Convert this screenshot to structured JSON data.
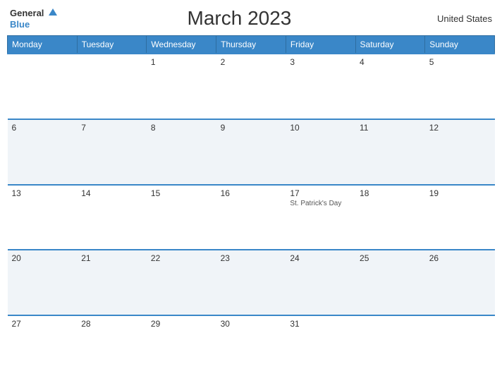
{
  "header": {
    "logo_general": "General",
    "logo_blue": "Blue",
    "title": "March 2023",
    "country": "United States"
  },
  "columns": [
    "Monday",
    "Tuesday",
    "Wednesday",
    "Thursday",
    "Friday",
    "Saturday",
    "Sunday"
  ],
  "weeks": [
    [
      {
        "day": "",
        "event": ""
      },
      {
        "day": "",
        "event": ""
      },
      {
        "day": "1",
        "event": ""
      },
      {
        "day": "2",
        "event": ""
      },
      {
        "day": "3",
        "event": ""
      },
      {
        "day": "4",
        "event": ""
      },
      {
        "day": "5",
        "event": ""
      }
    ],
    [
      {
        "day": "6",
        "event": ""
      },
      {
        "day": "7",
        "event": ""
      },
      {
        "day": "8",
        "event": ""
      },
      {
        "day": "9",
        "event": ""
      },
      {
        "day": "10",
        "event": ""
      },
      {
        "day": "11",
        "event": ""
      },
      {
        "day": "12",
        "event": ""
      }
    ],
    [
      {
        "day": "13",
        "event": ""
      },
      {
        "day": "14",
        "event": ""
      },
      {
        "day": "15",
        "event": ""
      },
      {
        "day": "16",
        "event": ""
      },
      {
        "day": "17",
        "event": "St. Patrick's Day"
      },
      {
        "day": "18",
        "event": ""
      },
      {
        "day": "19",
        "event": ""
      }
    ],
    [
      {
        "day": "20",
        "event": ""
      },
      {
        "day": "21",
        "event": ""
      },
      {
        "day": "22",
        "event": ""
      },
      {
        "day": "23",
        "event": ""
      },
      {
        "day": "24",
        "event": ""
      },
      {
        "day": "25",
        "event": ""
      },
      {
        "day": "26",
        "event": ""
      }
    ],
    [
      {
        "day": "27",
        "event": ""
      },
      {
        "day": "28",
        "event": ""
      },
      {
        "day": "29",
        "event": ""
      },
      {
        "day": "30",
        "event": ""
      },
      {
        "day": "31",
        "event": ""
      },
      {
        "day": "",
        "event": ""
      },
      {
        "day": "",
        "event": ""
      }
    ]
  ]
}
